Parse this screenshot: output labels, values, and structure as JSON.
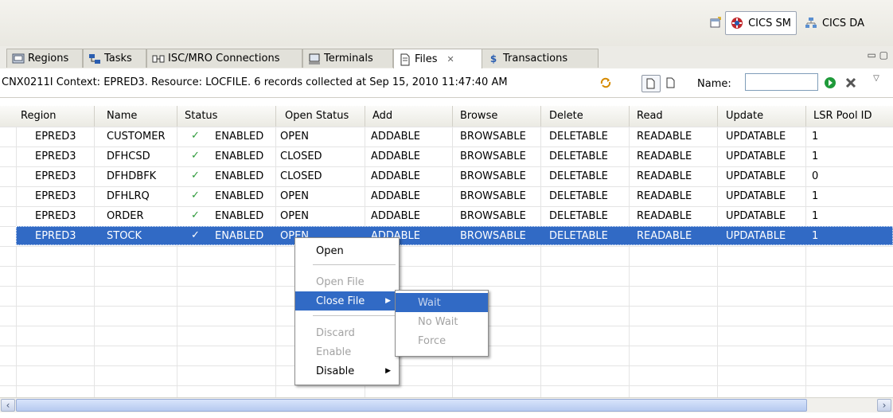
{
  "perspectives": {
    "sm": "CICS SM",
    "da": "CICS DA"
  },
  "tabs": [
    {
      "label": "Regions"
    },
    {
      "label": "Tasks"
    },
    {
      "label": "ISC/MRO Connections"
    },
    {
      "label": "Terminals"
    },
    {
      "label": "Files"
    },
    {
      "label": "Transactions"
    }
  ],
  "toolbar": {
    "context": "CNX0211I Context: EPRED3. Resource: LOCFILE. 6 records collected at Sep 15, 2010 11:47:40 AM",
    "name_label": "Name:",
    "name_value": ""
  },
  "columns": [
    "Region",
    "Name",
    "Status",
    "Open Status",
    "Add",
    "Browse",
    "Delete",
    "Read",
    "Update",
    "LSR Pool ID"
  ],
  "rows": [
    [
      "EPRED3",
      "CUSTOMER",
      "ENABLED",
      "OPEN",
      "ADDABLE",
      "BROWSABLE",
      "DELETABLE",
      "READABLE",
      "UPDATABLE",
      "1"
    ],
    [
      "EPRED3",
      "DFHCSD",
      "ENABLED",
      "CLOSED",
      "ADDABLE",
      "BROWSABLE",
      "DELETABLE",
      "READABLE",
      "UPDATABLE",
      "1"
    ],
    [
      "EPRED3",
      "DFHDBFK",
      "ENABLED",
      "CLOSED",
      "ADDABLE",
      "BROWSABLE",
      "DELETABLE",
      "READABLE",
      "UPDATABLE",
      "0"
    ],
    [
      "EPRED3",
      "DFHLRQ",
      "ENABLED",
      "OPEN",
      "ADDABLE",
      "BROWSABLE",
      "DELETABLE",
      "READABLE",
      "UPDATABLE",
      "1"
    ],
    [
      "EPRED3",
      "ORDER",
      "ENABLED",
      "OPEN",
      "ADDABLE",
      "BROWSABLE",
      "DELETABLE",
      "READABLE",
      "UPDATABLE",
      "1"
    ],
    [
      "EPRED3",
      "STOCK",
      "ENABLED",
      "OPEN",
      "ADDABLE",
      "BROWSABLE",
      "DELETABLE",
      "READABLE",
      "UPDATABLE",
      "1"
    ]
  ],
  "context_menu": {
    "open": "Open",
    "open_file": "Open File",
    "close_file": "Close File",
    "discard": "Discard",
    "enable": "Enable",
    "disable": "Disable"
  },
  "submenu": {
    "wait": "Wait",
    "no_wait": "No Wait",
    "force": "Force"
  },
  "colors": {
    "selection": "#316ac5",
    "check": "#2e9a3a"
  }
}
